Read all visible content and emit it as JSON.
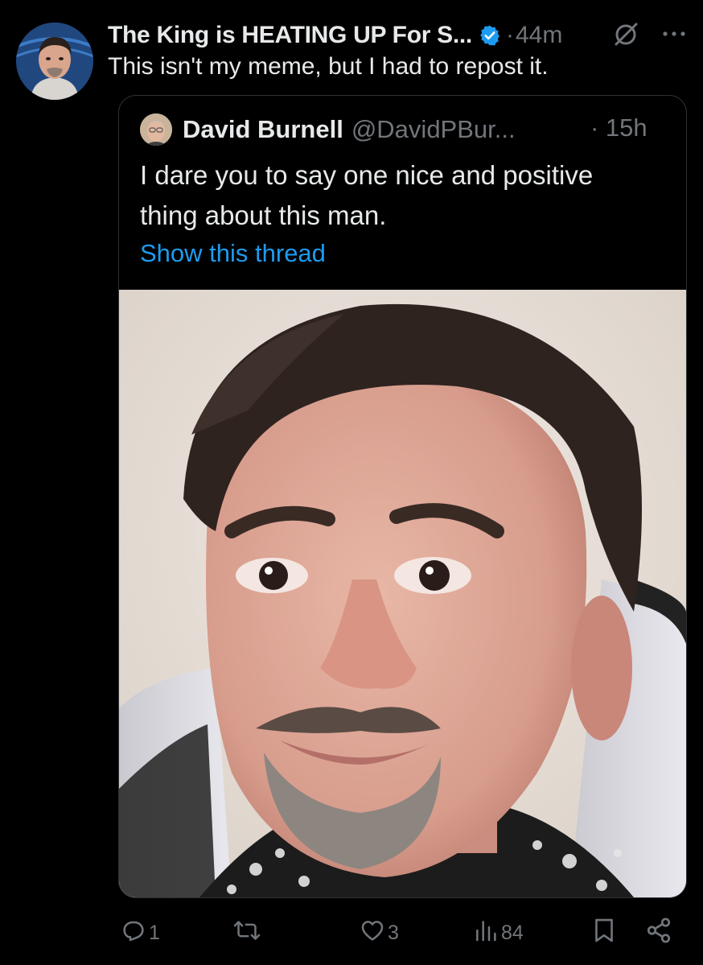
{
  "post": {
    "author_name": "The King is HEATING UP For S...",
    "separator": "·",
    "time": "44m",
    "text": "This isn't my meme, but I had to repost it."
  },
  "quote": {
    "author_name": "David Burnell",
    "handle": "@DavidPBur...",
    "time": "· 15h",
    "text": "I dare you to say one nice and positive thing about this man.",
    "show_thread": "Show this thread"
  },
  "actions": {
    "reply_count": "1",
    "repost_count": "",
    "like_count": "3",
    "views_count": "84"
  },
  "icons": {
    "verified": "verified-badge-icon",
    "mute": "mute-icon",
    "more": "more-options-icon",
    "reply": "reply-icon",
    "repost": "repost-icon",
    "like": "heart-icon",
    "views": "views-icon",
    "bookmark": "bookmark-icon",
    "share": "share-icon"
  },
  "colors": {
    "background": "#000000",
    "primary_text": "#e7e9ea",
    "secondary_text": "#71767b",
    "link": "#1d9bf0",
    "verified": "#1d9bf0",
    "border": "#2f3336"
  }
}
